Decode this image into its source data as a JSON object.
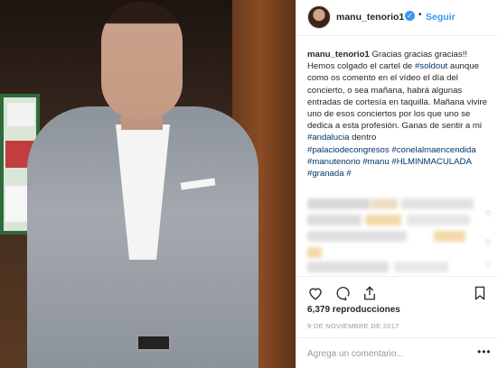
{
  "header": {
    "username": "manu_tenorio1",
    "verified_icon": "verified-badge-icon",
    "separator": "•",
    "follow_label": "Seguir"
  },
  "caption": {
    "user": "manu_tenorio1",
    "text": "Gracias gracias gracias!! Hemos colgado el cartel de",
    "tag_soldout": "#soldout",
    "text2": "aunque como os comento en el vídeo el día del concierto, o sea mañana, habrá algunas entradas de cortesía en taquilla. Mañana vivire uno de esos conciertos por los que uno se dedica a esta profesión. Ganas de sentir a mi",
    "tag_andalucia": "#andalucia",
    "text3": "dentro",
    "tags_line1": [
      "#palaciodecongresos",
      "#conelalmaencendida"
    ],
    "tags_line2": [
      "#manutenorio",
      "#manu",
      "#HLMINMACULADA"
    ],
    "tags_line3": [
      "#granada",
      "#"
    ]
  },
  "actions": {
    "like_icon": "heart-icon",
    "comment_icon": "comment-icon",
    "share_icon": "share-icon",
    "save_icon": "bookmark-icon"
  },
  "views": "6,379 reproducciones",
  "date": "9 DE NOVIEMBRE DE 2017",
  "comment": {
    "placeholder": "Agrega un comentario...",
    "more": "•••"
  },
  "colors": {
    "link": "#3897f0",
    "hashtag": "#003569",
    "muted": "#999999"
  }
}
